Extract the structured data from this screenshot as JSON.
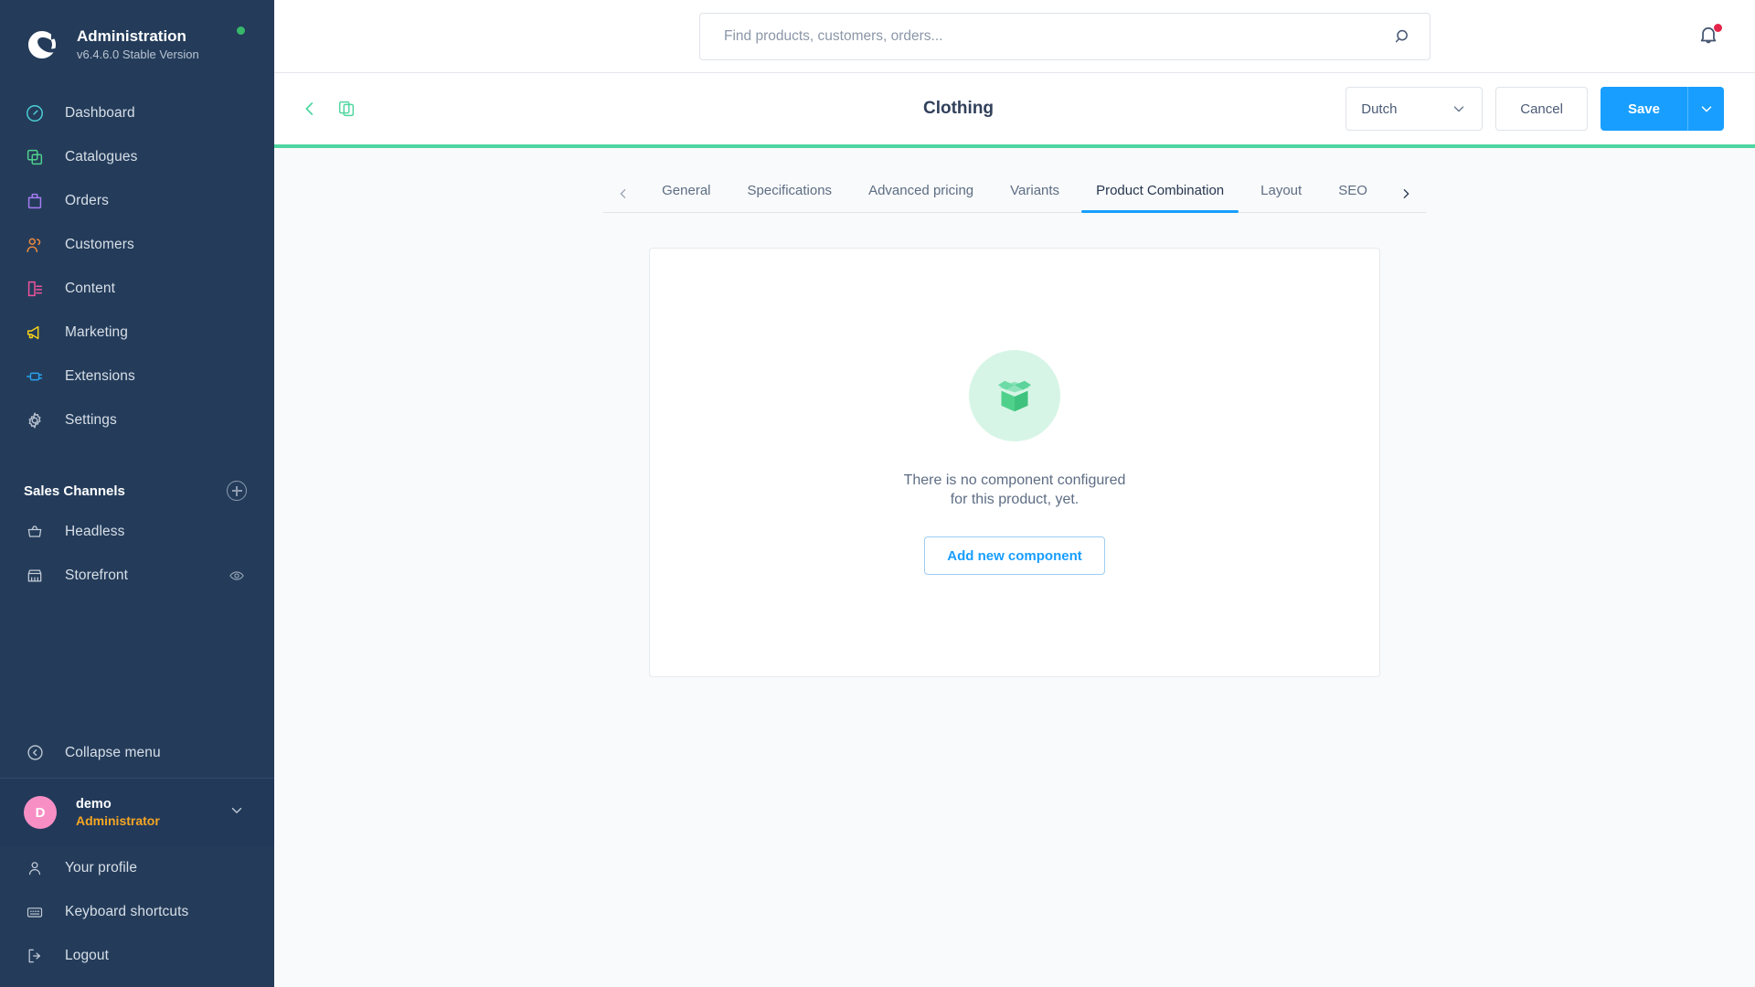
{
  "sidebar": {
    "brand": {
      "title": "Administration",
      "version": "v6.4.6.0 Stable Version",
      "status_color": "#37b86a"
    },
    "nav_items": [
      {
        "label": "Dashboard",
        "icon": "dashboard-icon",
        "color": "#4dcfd6"
      },
      {
        "label": "Catalogues",
        "icon": "catalogues-icon",
        "color": "#4fd18b"
      },
      {
        "label": "Orders",
        "icon": "orders-icon",
        "color": "#a67cf5"
      },
      {
        "label": "Customers",
        "icon": "customers-icon",
        "color": "#f08a3c"
      },
      {
        "label": "Content",
        "icon": "content-icon",
        "color": "#f0529c"
      },
      {
        "label": "Marketing",
        "icon": "marketing-icon",
        "color": "#f7d117"
      },
      {
        "label": "Extensions",
        "icon": "extensions-icon",
        "color": "#2aa2f0"
      },
      {
        "label": "Settings",
        "icon": "settings-icon",
        "color": "#b7c0cd"
      }
    ],
    "sales_channels": {
      "title": "Sales Channels",
      "add_label": "Add sales channel",
      "items": [
        {
          "label": "Headless",
          "icon": "basket-icon"
        },
        {
          "label": "Storefront",
          "icon": "store-icon",
          "trailing_icon": "eye-icon"
        }
      ]
    },
    "collapse": {
      "label": "Collapse menu",
      "icon": "collapse-icon"
    },
    "user": {
      "initial": "D",
      "name": "demo",
      "role": "Administrator",
      "caret_icon": "chevron-down-icon",
      "avatar_color": "#f88fc4"
    },
    "user_menu": [
      {
        "label": "Your profile",
        "icon": "user-icon"
      },
      {
        "label": "Keyboard shortcuts",
        "icon": "keyboard-icon"
      },
      {
        "label": "Logout",
        "icon": "logout-icon"
      }
    ]
  },
  "topbar": {
    "search_placeholder": "Find products, customers, orders...",
    "search_value": "",
    "search_icon": "search-icon",
    "bell_icon": "bell-icon",
    "bell_badge_color": "#e3264a"
  },
  "pagehead": {
    "back_icon": "chevron-left-icon",
    "duplicate_icon": "duplicate-icon",
    "title": "Clothing",
    "language": {
      "value": "Dutch",
      "caret_icon": "chevron-down-icon"
    },
    "cancel_label": "Cancel",
    "save_label": "Save",
    "save_caret_icon": "chevron-down-icon",
    "accent_color": "#4ed6a0"
  },
  "tabs": {
    "scroll_left_icon": "chevron-left-icon",
    "scroll_right_icon": "chevron-right-icon",
    "items": [
      {
        "label": "General",
        "active": false
      },
      {
        "label": "Specifications",
        "active": false
      },
      {
        "label": "Advanced pricing",
        "active": false
      },
      {
        "label": "Variants",
        "active": false
      },
      {
        "label": "Product Combination",
        "active": true
      },
      {
        "label": "Layout",
        "active": false
      },
      {
        "label": "SEO",
        "active": false
      }
    ]
  },
  "empty_state": {
    "illustration": "open-box-icon",
    "message_line1": "There is no component configured",
    "message_line2": "for this product, yet.",
    "button_label": "Add new component"
  }
}
